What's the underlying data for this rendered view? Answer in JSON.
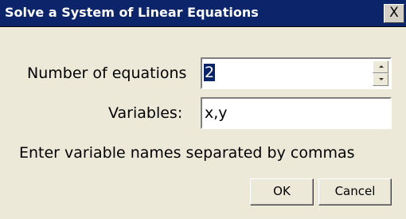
{
  "window": {
    "title": "Solve a System of Linear Equations",
    "close_symbol": "X"
  },
  "form": {
    "equations_label": "Number of equations",
    "equations_value": "2",
    "variables_label": "Variables:",
    "variables_value": "x,y",
    "hint": "Enter variable names separated by commas"
  },
  "buttons": {
    "ok": "OK",
    "cancel": "Cancel"
  },
  "icons": {
    "spin_up": "spin-up-arrow",
    "spin_down": "spin-down-arrow"
  },
  "colors": {
    "titlebar": "#0b246a",
    "dialog_bg": "#ece9d8",
    "selection": "#0a246a"
  }
}
